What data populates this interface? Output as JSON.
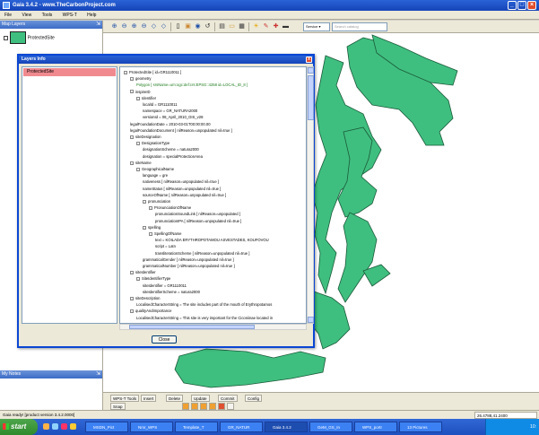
{
  "window": {
    "title": "Gaia 3.4.2 - www.TheCarbonProject.com",
    "min": "_",
    "max": "□",
    "close": "×"
  },
  "menu": [
    "File",
    "View",
    "Tools",
    "WPS-T",
    "Help"
  ],
  "toolbar": {
    "service_select": "Service ▾",
    "search_placeholder": "Search catalog"
  },
  "map_layers": {
    "title": "Map Layers",
    "pin": "⇲",
    "layer_name": "ProtectedSite",
    "layer_color": "#3fbf7f"
  },
  "layers_info": {
    "title": "Layers Info",
    "close": "x",
    "selected_layer": "ProtectedSite",
    "tree": [
      {
        "indent": 0,
        "toggle": "-",
        "text": "ProtectedSite [ id=GR1110011 ]"
      },
      {
        "indent": 1,
        "toggle": "-",
        "text": "geometry"
      },
      {
        "indent": 2,
        "toggle": "",
        "text": "Polygon [ srsName=urn:ogc:def:crs:EPSG::4258 id=LOCAL_ID_8 ]",
        "green": true
      },
      {
        "indent": 1,
        "toggle": "-",
        "text": "inspireID"
      },
      {
        "indent": 2,
        "toggle": "-",
        "text": "Identifier"
      },
      {
        "indent": 3,
        "toggle": "",
        "text": "localId = GR1110011"
      },
      {
        "indent": 3,
        "toggle": "",
        "text": "namespace = GR_NATURA2000"
      },
      {
        "indent": 3,
        "toggle": "",
        "text": "versionId = 08_April_2010_GIS_v28"
      },
      {
        "indent": 1,
        "toggle": "",
        "text": "legalFoundationDate = 2010-03-01T00:00:00.00"
      },
      {
        "indent": 1,
        "toggle": "",
        "text": "legalFoundationDocument [ nilReason=unpopulated nil=true ]"
      },
      {
        "indent": 1,
        "toggle": "-",
        "text": "siteDesignation"
      },
      {
        "indent": 2,
        "toggle": "-",
        "text": "DesignationType"
      },
      {
        "indent": 3,
        "toggle": "",
        "text": "designationScheme = natura2000"
      },
      {
        "indent": 3,
        "toggle": "",
        "text": "designation = specialProtectionArea"
      },
      {
        "indent": 1,
        "toggle": "-",
        "text": "siteName"
      },
      {
        "indent": 2,
        "toggle": "-",
        "text": "GeographicalName"
      },
      {
        "indent": 3,
        "toggle": "",
        "text": "language = gre"
      },
      {
        "indent": 3,
        "toggle": "",
        "text": "nativeness [ nilReason=unpopulated nil=true ]"
      },
      {
        "indent": 3,
        "toggle": "",
        "text": "nameStatus [ nilReason=unpopulated nil=true ]"
      },
      {
        "indent": 3,
        "toggle": "",
        "text": "sourceOfName [ nilReason=unpopulated nil=true ]"
      },
      {
        "indent": 3,
        "toggle": "-",
        "text": "pronunciation"
      },
      {
        "indent": 4,
        "toggle": "-",
        "text": "PronunciationOfName"
      },
      {
        "indent": 5,
        "toggle": "",
        "text": "pronunciationSoundLink [ nilReason=unpopulated ]"
      },
      {
        "indent": 5,
        "toggle": "",
        "text": "pronunciationIPA [ nilReason=unpopulated nil=true ]"
      },
      {
        "indent": 3,
        "toggle": "-",
        "text": "spelling"
      },
      {
        "indent": 4,
        "toggle": "-",
        "text": "SpellingOfName"
      },
      {
        "indent": 5,
        "toggle": "",
        "text": "text = KOILADA ERYTHROPOTAMOU ASVESTADES, KOUFOVOU"
      },
      {
        "indent": 5,
        "toggle": "",
        "text": "script = Latn"
      },
      {
        "indent": 5,
        "toggle": "",
        "text": "transliterationScheme [ nilReason=unpopulated nil=true ]"
      },
      {
        "indent": 3,
        "toggle": "",
        "text": "grammaticalGender [ nilReason=unpopulated nil=true ]"
      },
      {
        "indent": 3,
        "toggle": "",
        "text": "grammaticalNumber [ nilReason=unpopulated nil=true ]"
      },
      {
        "indent": 1,
        "toggle": "-",
        "text": "siteIdentifier"
      },
      {
        "indent": 2,
        "toggle": "-",
        "text": "SiteIdentifierType"
      },
      {
        "indent": 3,
        "toggle": "",
        "text": "siteIdentifier = GR1110011"
      },
      {
        "indent": 3,
        "toggle": "",
        "text": "siteIdentifierScheme = natura2000"
      },
      {
        "indent": 1,
        "toggle": "-",
        "text": "siteDescription"
      },
      {
        "indent": 2,
        "toggle": "",
        "text": "LocalisedCharacterString = The site includes part of the mouth of Erythropotamos"
      },
      {
        "indent": 1,
        "toggle": "-",
        "text": "qualityAndImportance"
      },
      {
        "indent": 2,
        "toggle": "",
        "text": "LocalisedCharacterString = This site is very important for the Ciconiinae located in"
      }
    ],
    "close_button": "Close"
  },
  "my_notes": {
    "title": "My Notes",
    "pin": "⇲"
  },
  "bottom_tabs": [
    "WPS-T Tools",
    "Insert",
    "Delete",
    "Update",
    "Commit",
    "Config"
  ],
  "snap": {
    "label": "Snap"
  },
  "status": {
    "text": "Gaia ready! [product version 3.4.2.0000]",
    "coords": "26.4788,41.2400"
  },
  "taskbar": {
    "start": "start",
    "tasks": [
      "MSDN_Pict",
      "Nmr_WPS",
      "Template_T",
      "GR_NATUR",
      "Gaia 3.4.2",
      "GeM_GS_In",
      "WPS_portr",
      "13 Pictures"
    ],
    "tray_time": "10:"
  }
}
